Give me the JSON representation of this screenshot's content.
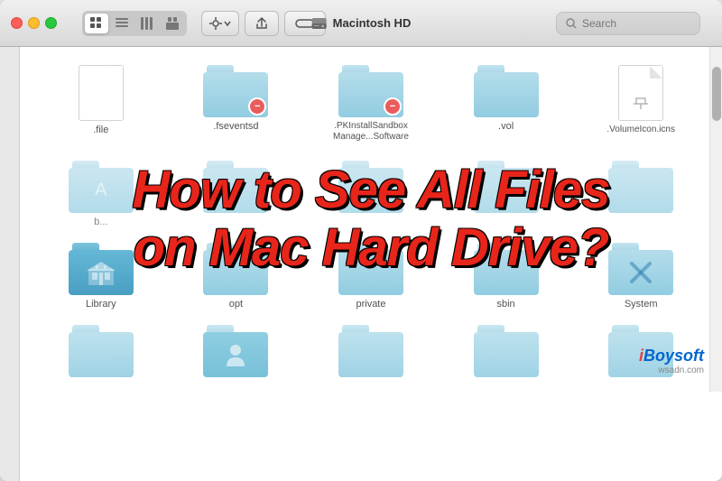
{
  "window": {
    "title": "Macintosh HD",
    "search_placeholder": "Search"
  },
  "toolbar": {
    "view_buttons": [
      "icon-grid",
      "list",
      "column",
      "gallery"
    ],
    "active_view": 0
  },
  "overlay": {
    "line1": "How to See All Files",
    "line2": "on Mac Hard Drive?"
  },
  "files_row1": [
    {
      "name": ".file",
      "type": "doc"
    },
    {
      "name": ".fseventsd",
      "type": "folder-restricted"
    },
    {
      "name": ".PKInstallSandbox\nManage...Software",
      "type": "folder-restricted"
    },
    {
      "name": ".vol",
      "type": "folder"
    },
    {
      "name": ".VolumeIcon.icns",
      "type": "doc"
    }
  ],
  "files_row2": [
    {
      "name": "b...",
      "type": "folder"
    },
    {
      "name": "",
      "type": "folder"
    },
    {
      "name": "",
      "type": "folder"
    },
    {
      "name": "",
      "type": "folder"
    },
    {
      "name": "",
      "type": "folder"
    }
  ],
  "files_row3": [
    {
      "name": "Library",
      "type": "folder-library"
    },
    {
      "name": "opt",
      "type": "folder"
    },
    {
      "name": "private",
      "type": "folder"
    },
    {
      "name": "sbin",
      "type": "folder"
    },
    {
      "name": "System",
      "type": "folder-system"
    }
  ],
  "files_row4": [
    {
      "name": "",
      "type": "folder"
    },
    {
      "name": "",
      "type": "folder-person"
    },
    {
      "name": "",
      "type": "folder"
    },
    {
      "name": "",
      "type": "folder"
    },
    {
      "name": "",
      "type": "folder"
    }
  ],
  "branding": {
    "logo": "iBoysoft",
    "logo_i": "i",
    "logo_rest": "Boysoft",
    "sub": "wsadn.com"
  }
}
